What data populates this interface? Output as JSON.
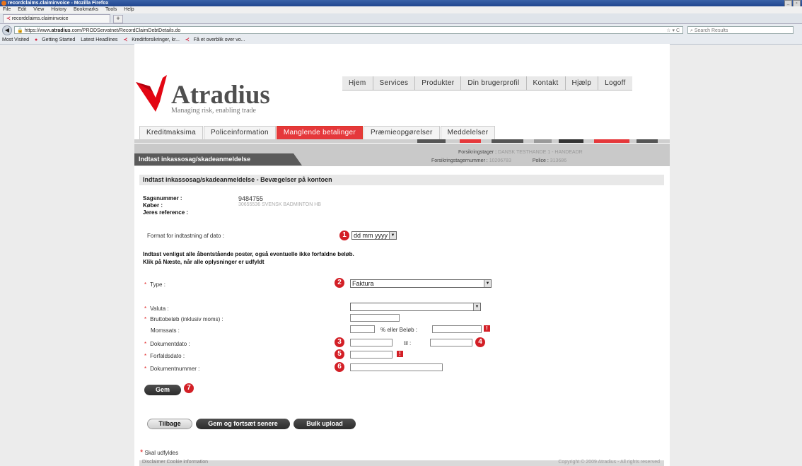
{
  "browser": {
    "window_title": "recordclaims.claiminvoice - Mozilla Firefox",
    "menu": [
      "File",
      "Edit",
      "View",
      "History",
      "Bookmarks",
      "Tools",
      "Help"
    ],
    "tab_title": "recordclaims.claiminvoice",
    "new_tab": "+",
    "url_prefix": "https://www.",
    "url_domain": "atradius",
    "url_suffix": ".com/PRODServatnet/RecordClaimDebtDetails.do",
    "search_placeholder": "Search Results",
    "bookmarks": [
      "Most Visited",
      "Getting Started",
      "Latest Headlines",
      "Kreditforsikringer, kr...",
      "Få et overblik over vo..."
    ]
  },
  "logo": {
    "name": "Atradius",
    "tagline": "Managing risk, enabling trade"
  },
  "top_nav": [
    "Hjem",
    "Services",
    "Produkter",
    "Din brugerprofil",
    "Kontakt",
    "Hjælp",
    "Logoff"
  ],
  "main_tabs": [
    {
      "label": "Kreditmaksima",
      "active": false
    },
    {
      "label": "Policeinformation",
      "active": false
    },
    {
      "label": "Manglende betalinger",
      "active": true
    },
    {
      "label": "Præmieopgørelser",
      "active": false
    },
    {
      "label": "Meddelelser",
      "active": false
    }
  ],
  "subheader": {
    "title": "Indtast inkassosag/skadeanmeldelse",
    "forsikringstager_label": "Forsikringstager :",
    "forsikringstager_value": "DANSK TESTHANDE 1 - HANDEADR",
    "forsikringstagernummer_label": "Forsikringstagernummer :",
    "forsikringstagernummer_value": "10206783",
    "police_label": "Police :",
    "police_value": "313686"
  },
  "section_title": "Indtast inkassosag/skadeanmeldelse - Bevægelser på kontoen",
  "case": {
    "sagsnummer_label": "Sagsnummer :",
    "sagsnummer_value": "9484755",
    "koeber_label": "Køber :",
    "koeber_value": "30655536 SVENSK BADMINTON HB",
    "reference_label": "Jeres reference :"
  },
  "date_format": {
    "label": "Format for indtastning af dato :",
    "value": "dd mm yyyy"
  },
  "instructions": [
    "Indtast venligst alle åbentstående poster, også eventuelle ikke forfaldne beløb.",
    "Klik på Næste, når alle oplysninger er udfyldt"
  ],
  "form": {
    "type_label": "Type :",
    "type_value": "Faktura",
    "valuta_label": "Valuta :",
    "valuta_value": "",
    "brutto_label": "Bruttobeløb (inklusiv moms) :",
    "moms_label": "Momssats :",
    "moms_mid": "% eller Beløb :",
    "dokumentdato_label": "Dokumentdato :",
    "til_label": "til :",
    "forfaldsdato_label": "Forfaldsdato :",
    "dokumentnummer_label": "Dokumentnummer :",
    "warning_glyph": "!"
  },
  "markers": [
    "1",
    "2",
    "3",
    "4",
    "5",
    "6",
    "7"
  ],
  "buttons": {
    "gem": "Gem",
    "tilbage": "Tilbage",
    "gem_fortsaet": "Gem og fortsæt senere",
    "bulk": "Bulk upload"
  },
  "required_note": "Skal udfyldes",
  "required_star": "*",
  "footer": {
    "left": "Disclaimer    Cookie information",
    "right": "Copyright © 2009 Atradius - All rights reserved"
  }
}
